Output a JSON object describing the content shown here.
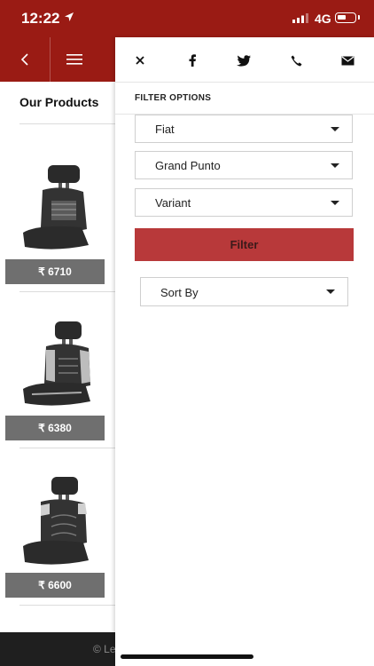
{
  "status": {
    "time": "12:22",
    "network": "4G"
  },
  "products": {
    "title": "Our Products",
    "items": [
      {
        "price": "₹ 6710"
      },
      {
        "price": "₹ 6380"
      },
      {
        "price": "₹ 6600"
      }
    ]
  },
  "footer": {
    "copyright": "© Le"
  },
  "drawer": {
    "heading": "FILTER OPTIONS",
    "make": {
      "value": "Fiat"
    },
    "model": {
      "value": "Grand Punto"
    },
    "variant": {
      "value": "Variant"
    },
    "filter_label": "Filter",
    "sort_label": "Sort By"
  },
  "colors": {
    "brand": "#9a1b14",
    "filter_button": "#b8393a"
  }
}
